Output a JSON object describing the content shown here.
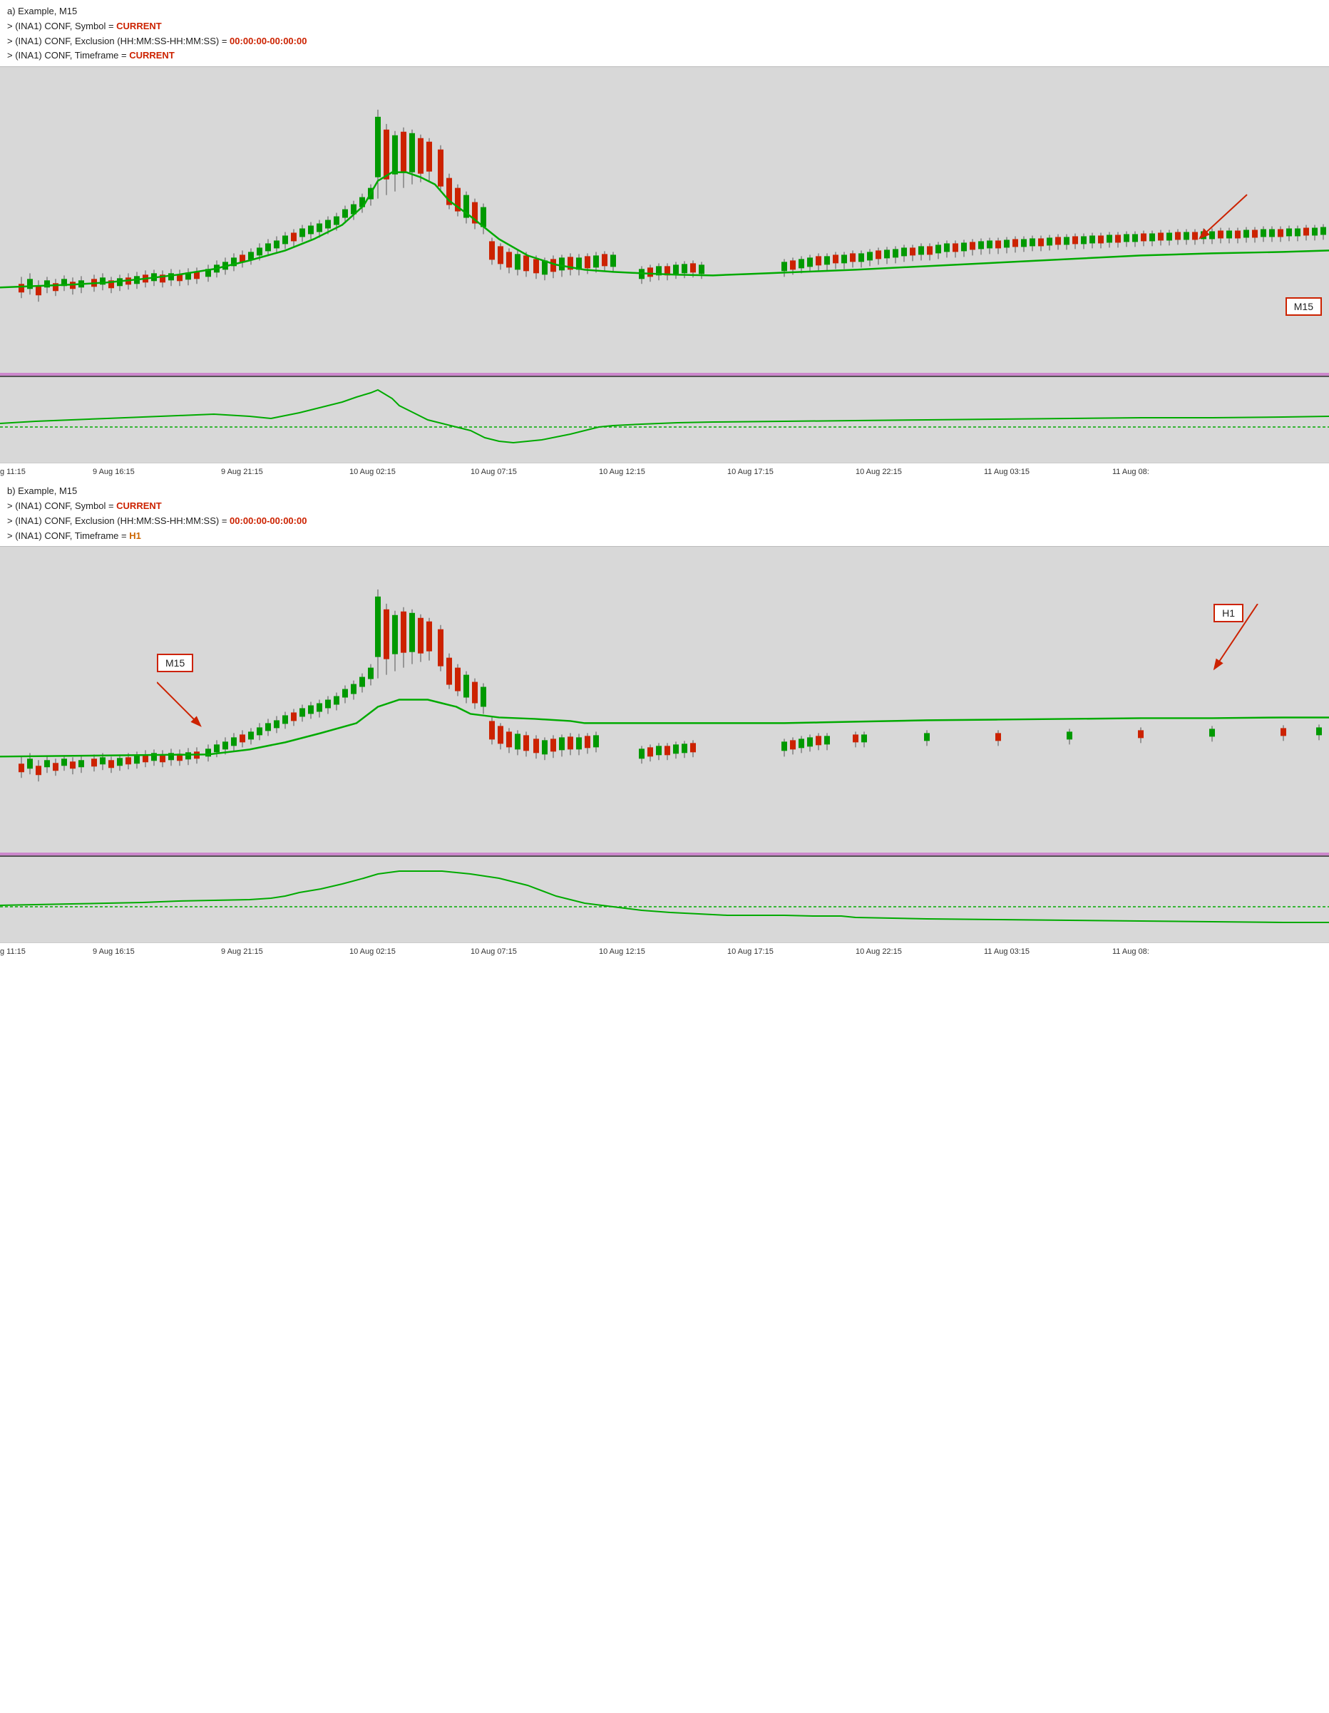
{
  "sectionA": {
    "title": "a) Example, M15",
    "lines": [
      {
        "prefix": "> (INA1) CONF, Symbol = ",
        "value": "CURRENT",
        "value_color": "red"
      },
      {
        "prefix": "> (INA1) CONF, Exclusion (HH:MM:SS-HH:MM:SS) = ",
        "value": "00:00:00-00:00:00",
        "value_color": "red"
      },
      {
        "prefix": "> (INA1) CONF, Timeframe = ",
        "value": "CURRENT",
        "value_color": "red"
      }
    ],
    "annotation": "M15",
    "timeLabels": [
      "g 11:15",
      "9 Aug 16:15",
      "9 Aug 21:15",
      "10 Aug 02:15",
      "10 Aug 07:15",
      "10 Aug 12:15",
      "10 Aug 17:15",
      "10 Aug 22:15",
      "11 Aug 03:15",
      "11 Aug 08:"
    ]
  },
  "sectionB": {
    "title": "b) Example, M15",
    "lines": [
      {
        "prefix": "> (INA1) CONF, Symbol = ",
        "value": "CURRENT",
        "value_color": "red"
      },
      {
        "prefix": "> (INA1) CONF, Exclusion (HH:MM:SS-HH:MM:SS) = ",
        "value": "00:00:00-00:00:00",
        "value_color": "red"
      },
      {
        "prefix": "> (INA1) CONF, Timeframe = ",
        "value": "H1",
        "value_color": "orange"
      }
    ],
    "annotations": [
      "M15",
      "H1"
    ],
    "timeLabels": [
      "g 11:15",
      "9 Aug 16:15",
      "9 Aug 21:15",
      "10 Aug 02:15",
      "10 Aug 07:15",
      "10 Aug 12:15",
      "10 Aug 17:15",
      "10 Aug 22:15",
      "11 Aug 03:15",
      "11 Aug 08:"
    ]
  },
  "colors": {
    "red_candle": "#cc2200",
    "green_candle": "#009900",
    "ma_line": "#00aa00",
    "annotation_border": "#cc2200",
    "purple": "#cc88cc",
    "osc_line": "#00aa00",
    "osc_zero": "#00aa00",
    "background": "#d8d8d8"
  }
}
